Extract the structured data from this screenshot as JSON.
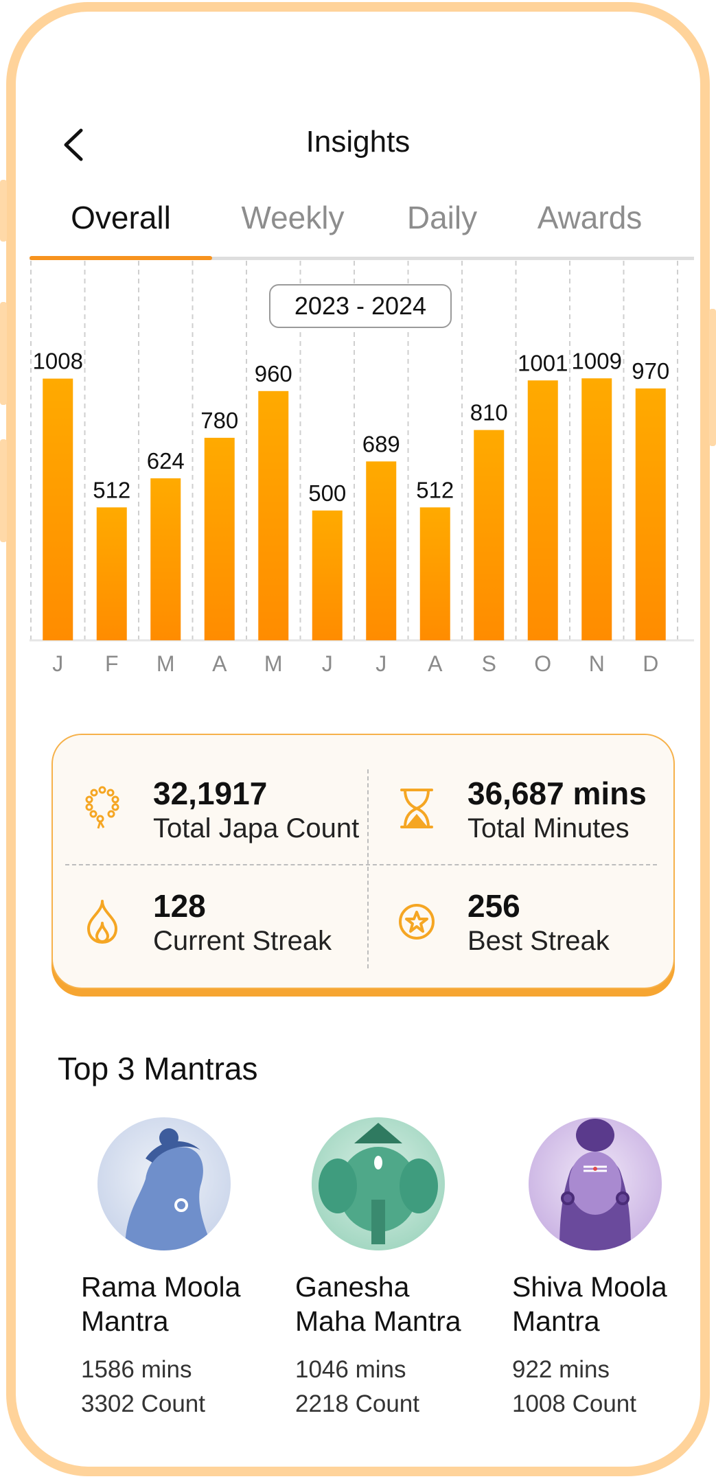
{
  "header": {
    "title": "Insights"
  },
  "tabs": [
    {
      "label": "Overall",
      "active": true
    },
    {
      "label": "Weekly",
      "active": false
    },
    {
      "label": "Daily",
      "active": false
    },
    {
      "label": "Awards",
      "active": false
    }
  ],
  "chart_data": {
    "type": "bar",
    "categories": [
      "J",
      "F",
      "M",
      "A",
      "M",
      "J",
      "J",
      "A",
      "S",
      "O",
      "N",
      "D"
    ],
    "values": [
      1008,
      512,
      624,
      780,
      960,
      500,
      689,
      512,
      810,
      1001,
      1009,
      970
    ],
    "title": "2023 - 2024",
    "xlabel": "",
    "ylabel": "",
    "ylim": [
      0,
      1200
    ],
    "grid": "vertical-dashed",
    "bar_color_top": "#ffaa00",
    "bar_color_bottom": "#ff8c00"
  },
  "stats": {
    "total_japa": {
      "value": "32,1917",
      "label": "Total Japa Count",
      "icon": "mala-beads-icon"
    },
    "total_minutes": {
      "value": "36,687 mins",
      "label": "Total Minutes",
      "icon": "hourglass-icon"
    },
    "current_streak": {
      "value": "128",
      "label": "Current Streak",
      "icon": "flame-icon"
    },
    "best_streak": {
      "value": "256",
      "label": "Best Streak",
      "icon": "star-circle-icon"
    }
  },
  "mantras": {
    "title": "Top 3 Mantras",
    "items": [
      {
        "name_line1": "Rama Moola",
        "name_line2": "Mantra",
        "mins": "1586 mins",
        "count": "3302 Count",
        "color": "#5b7fc0"
      },
      {
        "name_line1": "Ganesha",
        "name_line2": "Maha Mantra",
        "mins": "1046 mins",
        "count": "2218 Count",
        "color": "#3f9c7e"
      },
      {
        "name_line1": "Shiva Moola",
        "name_line2": "Mantra",
        "mins": "922 mins",
        "count": "1008 Count",
        "color": "#7a55a8"
      }
    ]
  },
  "colors": {
    "accent": "#f7931e",
    "frame": "#ffd39a",
    "card_bg": "#fdf9f3"
  }
}
